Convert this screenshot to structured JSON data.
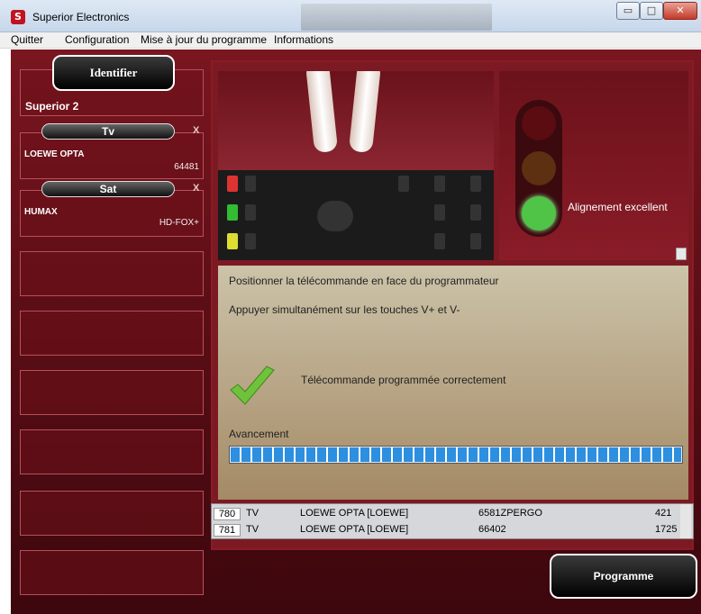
{
  "window": {
    "title": "Superior Electronics",
    "icon_letter": "S",
    "controls": {
      "minimize": "▭",
      "maximize": "□",
      "close": "✕"
    }
  },
  "menu": {
    "items": [
      "Quitter",
      "Configuration",
      "Mise à jour du programme",
      "Informations"
    ]
  },
  "sidebar": {
    "identify_label": "Identifier",
    "device_title": "Superior 2",
    "slots": [
      {
        "type": "Tv",
        "brand": "LOEWE OPTA",
        "code": "64481",
        "remove": "X"
      },
      {
        "type": "Sat",
        "brand": "HUMAX",
        "code": "HD-FOX+",
        "remove": "X"
      }
    ]
  },
  "status": {
    "alignment_text": "Alignement excellent",
    "light_state": "green",
    "colors": {
      "red_off": "#5a0c10",
      "orange_off": "#5c3011",
      "green_on": "#4fc447"
    }
  },
  "instructions": {
    "line1": "Positionner la télécommande en face du programmateur",
    "line2": "Appuyer simultanément sur les touches V+ et V-",
    "success": "Télécommande programmée correctement",
    "check_icon": "checkmark-icon"
  },
  "progress": {
    "label": "Avancement",
    "value_percent": 100
  },
  "table": {
    "rows": [
      {
        "num": "780",
        "type": "TV",
        "model": "LOEWE OPTA [LOEWE]",
        "code": "6581ZPERGO",
        "value": "421"
      },
      {
        "num": "781",
        "type": "TV",
        "model": "LOEWE OPTA [LOEWE]",
        "code": "66402",
        "value": "1725"
      }
    ]
  },
  "program_button": "Programme"
}
